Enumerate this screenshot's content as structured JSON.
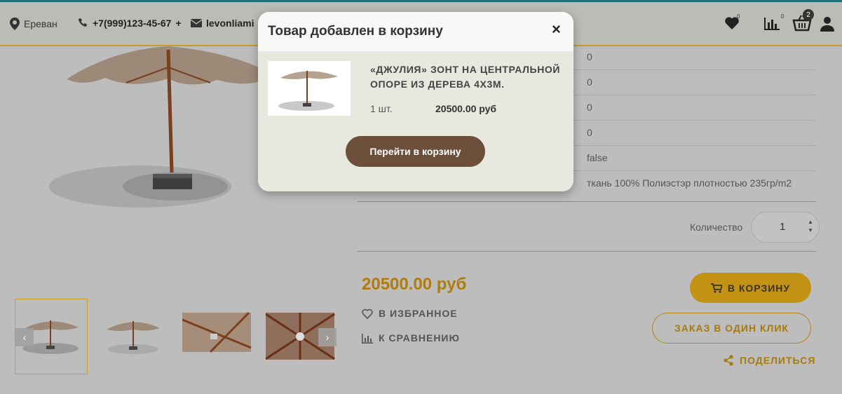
{
  "header": {
    "city": "Ереван",
    "phone": "+7(999)123-45-67",
    "phone_plus": "+",
    "email": "levonliami",
    "wishlist_count": "0",
    "compare_count": "0",
    "cart_count": "2"
  },
  "specs": {
    "values": [
      "0",
      "0",
      "0",
      "0",
      "false",
      "ткань 100% Полиэстэр плотностью 235гр/m2"
    ]
  },
  "quantity": {
    "label": "Количество",
    "value": "1"
  },
  "product": {
    "price": "20500.00 руб",
    "wishlist_label": "В ИЗБРАННОЕ",
    "compare_label": "К СРАВНЕНИЮ",
    "cart_button": "В КОРЗИНУ",
    "oneclick_button": "ЗАКАЗ В ОДИН КЛИК",
    "share_label": "ПОДЕЛИТЬСЯ"
  },
  "modal": {
    "title": "Товар добавлен в корзину",
    "close": "×",
    "product_name": "«ДЖУЛИЯ» ЗОНТ НА ЦЕНТРАЛЬНОЙ ОПОРЕ ИЗ ДЕРЕВА 4Х3М.",
    "qty": "1 шт.",
    "price": "20500.00 руб",
    "go_to_cart": "Перейти в корзину"
  },
  "colors": {
    "accent": "#c39213",
    "modal_button": "#6b4f3a",
    "header_border": "#1f6f78"
  },
  "icons": [
    "map-marker-icon",
    "phone-icon",
    "envelope-icon",
    "heart-icon",
    "bar-chart-icon",
    "basket-icon",
    "user-icon",
    "cart-icon",
    "share-icon",
    "chevron-left-icon",
    "chevron-right-icon",
    "close-icon"
  ]
}
